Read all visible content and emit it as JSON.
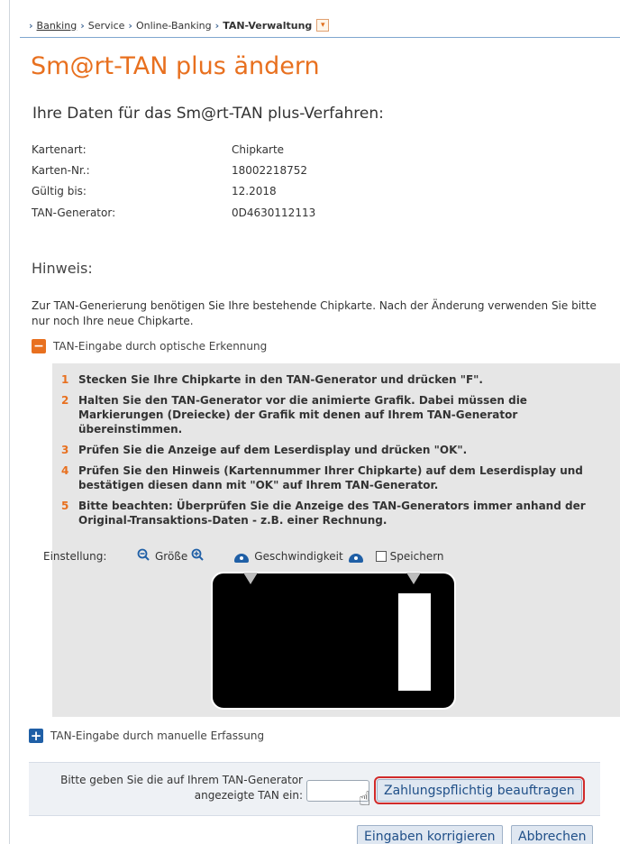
{
  "breadcrumb": {
    "items": [
      "Banking",
      "Service",
      "Online-Banking",
      "TAN-Verwaltung"
    ]
  },
  "page": {
    "title": "Sm@rt-TAN plus ändern",
    "subtitle": "Ihre Daten für das Sm@rt-TAN plus-Verfahren:"
  },
  "details": [
    {
      "label": "Kartenart:",
      "value": "Chipkarte"
    },
    {
      "label": "Karten-Nr.:",
      "value": "18002218752"
    },
    {
      "label": "Gültig bis:",
      "value": "12.2018"
    },
    {
      "label": "TAN-Generator:",
      "value": "0D4630112113"
    }
  ],
  "hint": {
    "heading": "Hinweis:",
    "text": "Zur TAN-Generierung benötigen Sie Ihre bestehende Chipkarte. Nach der Änderung verwenden Sie bitte nur noch Ihre neue Chipkarte."
  },
  "optical": {
    "toggle_label": "TAN-Eingabe durch optische Erkennung",
    "steps": [
      {
        "num": "1",
        "text": "Stecken Sie Ihre Chipkarte in den TAN-Generator und drücken \"F\"."
      },
      {
        "num": "2",
        "text": "Halten Sie den TAN-Generator vor die animierte Grafik. Dabei müssen die Markierungen (Dreiecke) der Grafik mit denen auf Ihrem TAN-Generator übereinstimmen."
      },
      {
        "num": "3",
        "text": "Prüfen Sie die Anzeige auf dem Leserdisplay und drücken \"OK\"."
      },
      {
        "num": "4",
        "text": "Prüfen Sie den Hinweis (Kartennummer Ihrer Chipkarte) auf dem Leserdisplay und bestätigen diesen dann mit \"OK\" auf Ihrem TAN-Generator."
      },
      {
        "num": "5",
        "text": "Bitte beachten: Überprüfen Sie die Anzeige des TAN-Generators immer anhand der Original-Transaktions-Daten - z.B. einer Rechnung."
      }
    ],
    "settings_label": "Einstellung:",
    "size_label": "Größe",
    "speed_label": "Geschwindigkeit",
    "save_label": "Speichern"
  },
  "manual": {
    "toggle_label": "TAN-Eingabe durch manuelle Erfassung"
  },
  "tan": {
    "label_line1": "Bitte geben Sie die auf Ihrem TAN-Generator",
    "label_line2": "angezeigte TAN ein:",
    "submit_label": "Zahlungspflichtig beauftragen"
  },
  "actions": {
    "correct_label": "Eingaben korrigieren",
    "cancel_label": "Abbrechen"
  },
  "colors": {
    "accent": "#e8701f",
    "link": "#1f4f88",
    "highlight": "#d12a2a"
  }
}
